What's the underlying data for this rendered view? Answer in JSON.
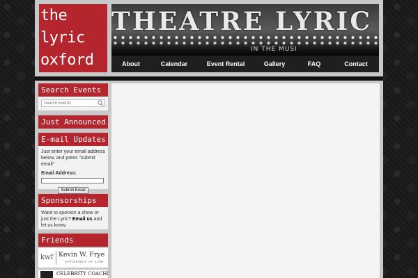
{
  "logo": {
    "lines": [
      "the",
      "lyric",
      "oxford"
    ]
  },
  "banner": {
    "marquee": "THEATRE  LYRIC",
    "sub": "IN THE MUSI"
  },
  "nav": {
    "items": [
      "About",
      "Calendar",
      "Event Rental",
      "Gallery",
      "FAQ",
      "Contact"
    ]
  },
  "sidebar": {
    "search": {
      "title": "Search Events",
      "placeholder": "Search Events"
    },
    "just_announced": {
      "title": "Just Announced"
    },
    "email": {
      "title": "E-mail Updates",
      "text": "Just enter your email address below, and press \"submit email\"",
      "label": "Email Address:",
      "button": "Submit Email"
    },
    "sponsorships": {
      "title": "Sponsorships",
      "text_before": "Want to sponsor a show or just the Lyric?",
      "link": "Email us",
      "text_after": "and let us know."
    },
    "friends": {
      "title": "Friends",
      "frye": {
        "mark": "kwf",
        "name": "Kevin W. Frye",
        "sub": "ATTORNEY AT LAW"
      },
      "celebrity": {
        "name": "CELEBRITY COACHES"
      }
    }
  },
  "colors": {
    "brand_red": "#b5252d",
    "nav_bg": "#1f1f1f",
    "page_bg": "#141414"
  }
}
